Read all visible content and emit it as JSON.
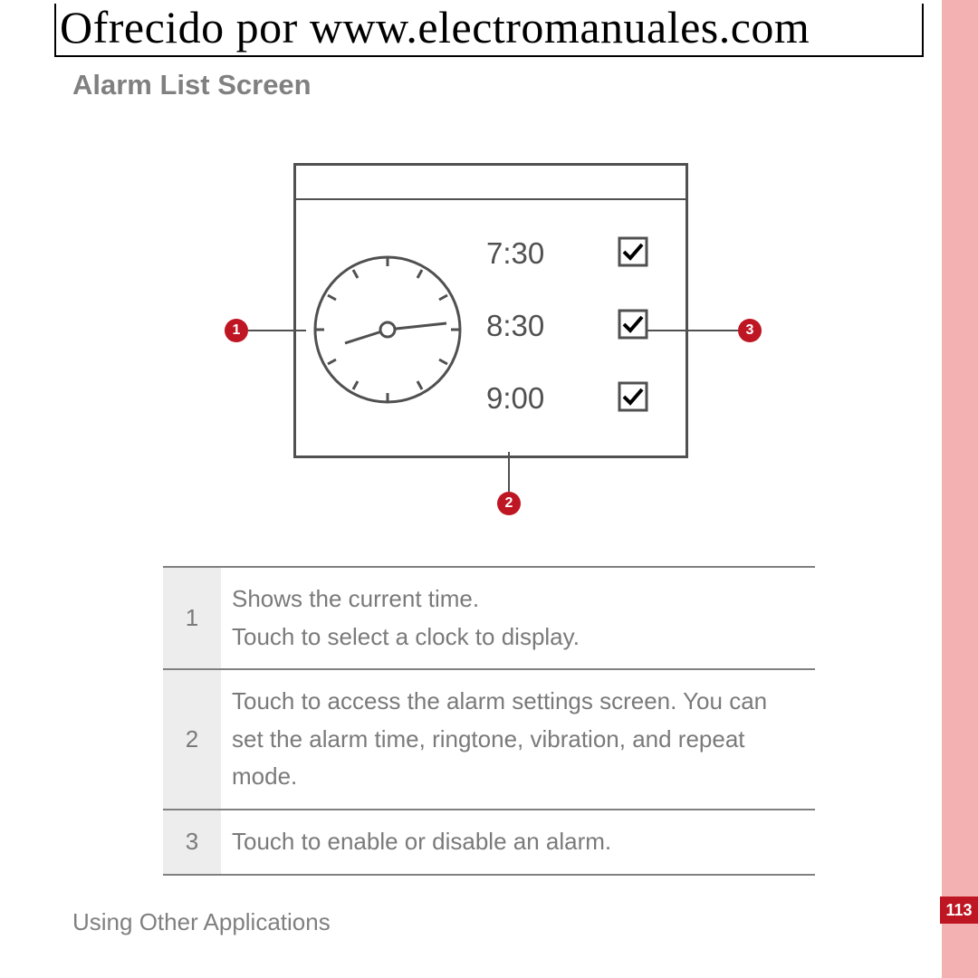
{
  "watermark": "Ofrecido por www.electromanuales.com",
  "section_title": "Alarm List Screen",
  "alarms": {
    "t1": "7:30",
    "t2": "8:30",
    "t3": "9:00"
  },
  "callouts": {
    "c1": "1",
    "c2": "2",
    "c3": "3"
  },
  "table": {
    "r1": {
      "num": "1",
      "text": "Shows the current time.\nTouch to select a clock to display."
    },
    "r2": {
      "num": "2",
      "text": "Touch to access the alarm settings screen. You can set the alarm time, ringtone, vibration, and repeat mode."
    },
    "r3": {
      "num": "3",
      "text": "Touch to enable or disable an alarm."
    }
  },
  "footer": "Using Other Applications",
  "page_number": "113"
}
